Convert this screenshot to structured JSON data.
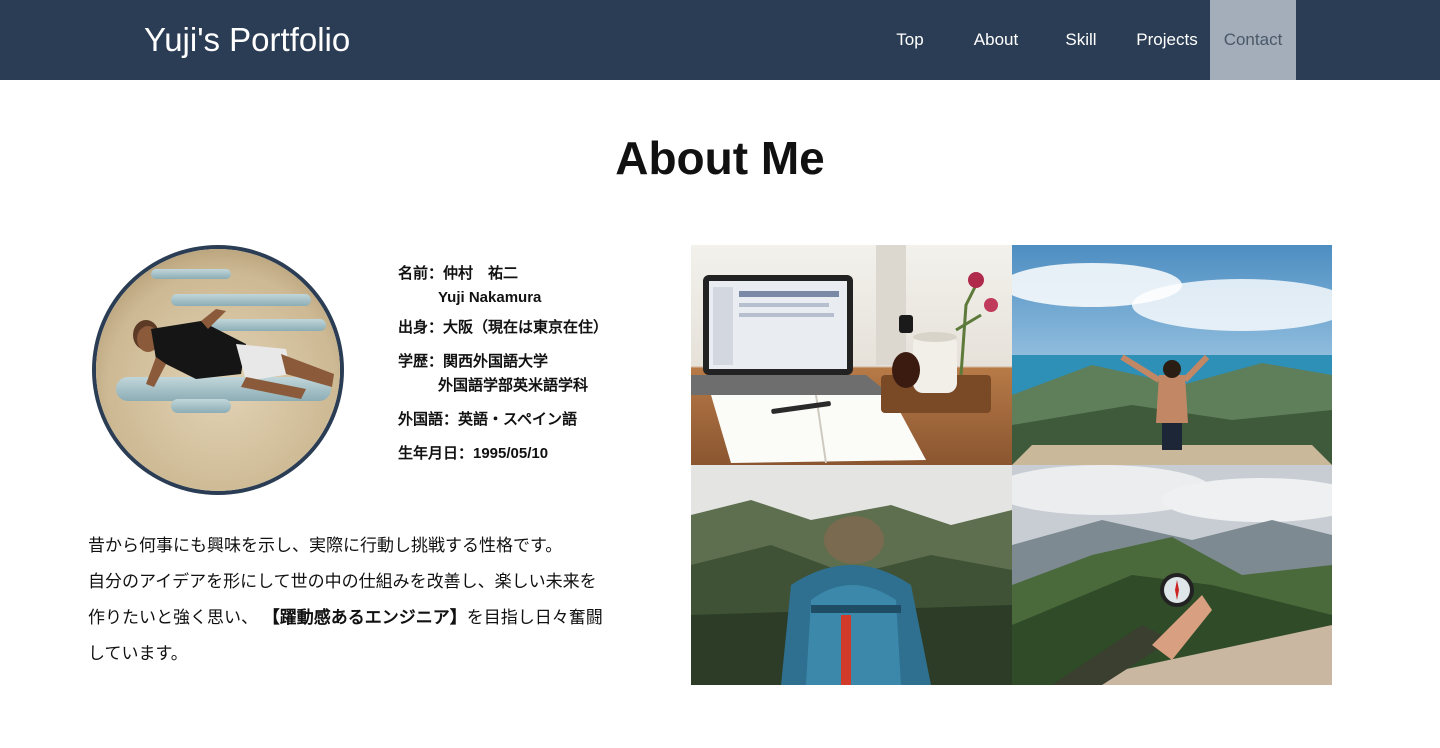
{
  "header": {
    "logo": "Yuji's Portfolio",
    "nav": [
      {
        "label": "Top",
        "active": false
      },
      {
        "label": "About",
        "active": false
      },
      {
        "label": "Skill",
        "active": false
      },
      {
        "label": "Projects",
        "active": false
      },
      {
        "label": "Contact",
        "active": true
      }
    ]
  },
  "about": {
    "title": "About Me",
    "profile": {
      "name_label": "名前：仲村　祐二",
      "name_en": "Yuji Nakamura",
      "origin": "出身：大阪（現在は東京在住）",
      "education_label": "学歴：関西外国語大学",
      "education_dept": "外国語学部英米語学科",
      "languages": "外国語：英語・スペイン語",
      "birthday": "生年月日：1995/05/10"
    },
    "bio": {
      "line1": "昔から何事にも興味を示し、実際に行動し挑戦する性格です。",
      "line2": "自分のアイデアを形にして世の中の仕組みを改善し、楽しい未来を",
      "line3_pre": "作りたいと強く思い、 ",
      "line3_bold": "【躍動感あるエンジニア】",
      "line3_post": "を目指し日々奮闘",
      "line4": "しています。"
    }
  },
  "colors": {
    "header_bg": "#2b3d54",
    "nav_active_bg": "#a3aeba",
    "avatar_border": "#2b3d54"
  },
  "icons": {
    "avatar": "profile-photo",
    "gallery": [
      "laptop-desk-photo",
      "mountain-view-photo",
      "backpack-hiker-photo",
      "compass-mountain-photo"
    ]
  }
}
